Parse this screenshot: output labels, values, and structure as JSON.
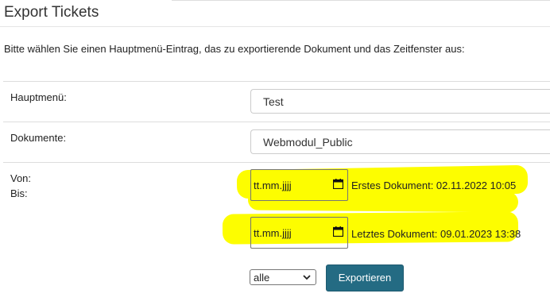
{
  "header": {
    "title": "Export Tickets"
  },
  "intro_text": "Bitte wählen Sie einen Hauptmenü-Eintrag, das zu exportierende Dokument und das Zeitfenster aus:",
  "form": {
    "hauptmenu": {
      "label": "Hauptmenü:",
      "value": "Test"
    },
    "dokumente": {
      "label": "Dokumente:",
      "value": "Webmodul_Public"
    },
    "von": {
      "label": "Von:",
      "placeholder": "tt.mm.jjjj",
      "info": "Erstes Dokument: 02.11.2022 10:05"
    },
    "bis": {
      "label": "Bis:",
      "placeholder": "tt.mm.jjjj",
      "info": "Letztes Dokument: 09.01.2023 13:38"
    },
    "filter_select": {
      "value": "alle"
    },
    "export_button": {
      "label": "Exportieren"
    }
  },
  "colors": {
    "highlight": "#fdfd00",
    "button_bg": "#246b83",
    "button_text": "#ffffff"
  },
  "icons": {
    "calendar": "calendar-icon",
    "select_arrow": "chevron-down-icon"
  }
}
